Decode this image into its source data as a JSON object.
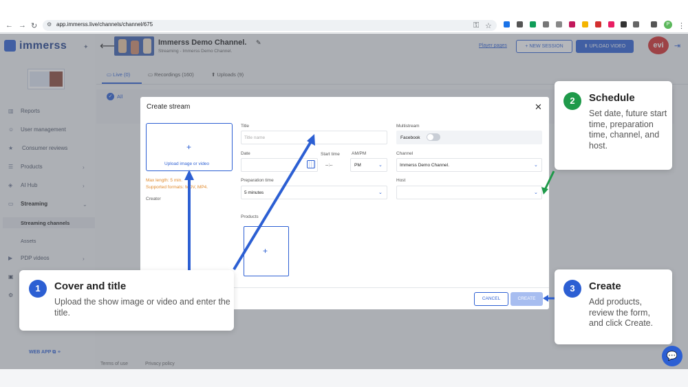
{
  "browser": {
    "url": "app.immerss.live/channels/channel/675",
    "profile_letter": "P"
  },
  "sidebar": {
    "logo_text": "immerss",
    "items": [
      {
        "label": "Reports",
        "icon": "bar-chart-icon"
      },
      {
        "label": "User management",
        "icon": "users-icon"
      },
      {
        "label": "Consumer reviews",
        "icon": "star-icon"
      },
      {
        "label": "Products",
        "icon": "list-icon"
      },
      {
        "label": "AI Hub",
        "icon": "ai-icon"
      },
      {
        "label": "Streaming",
        "icon": "streaming-icon"
      },
      {
        "label": "PDP videos",
        "icon": "video-icon"
      }
    ],
    "sub_items": [
      "Streaming channels",
      "Assets"
    ],
    "web_app": "WEB APP"
  },
  "header": {
    "channel_title": "Immerss Demo Channel.",
    "channel_subtitle": "Streaming - Immerss Demo Channel.",
    "player_pages": "Player pages",
    "new_session": "NEW SESSION",
    "upload_video": "UPLOAD VIDEO",
    "avatar_text": "evi"
  },
  "tabs": [
    {
      "label": "Live (0)"
    },
    {
      "label": "Recordings (160)"
    },
    {
      "label": "Uploads (9)"
    }
  ],
  "filter": {
    "all": "All"
  },
  "footer": {
    "terms": "Terms of use",
    "privacy": "Privacy policy"
  },
  "modal": {
    "title": "Create stream",
    "upload_label": "Upload image or video",
    "max_length": "Max length: 5 min.",
    "formats": "Supported formats: MOV, MP4.",
    "creator_label": "Creator",
    "title_label": "Title",
    "title_placeholder": "Title name",
    "date_label": "Date",
    "start_time_label": "Start time",
    "start_time_value": "--:--",
    "ampm_label": "AM/PM",
    "ampm_value": "PM",
    "prep_label": "Preparation time",
    "prep_value": "5 minutes",
    "multistream_label": "Multistream",
    "facebook_label": "Facebook",
    "channel_label": "Channel",
    "channel_value": "Immerss Demo Channel.",
    "host_label": "Host",
    "products_label": "Products",
    "cancel": "CANCEL",
    "create": "CREATE"
  },
  "callouts": [
    {
      "num": "1",
      "title": "Cover and title",
      "body": "Upload the show image or video and enter the title."
    },
    {
      "num": "2",
      "title": "Schedule",
      "body": "Set date, future start time, preparation time, channel, and host."
    },
    {
      "num": "3",
      "title": "Create",
      "body": "Add products, review the form, and click Create."
    }
  ],
  "colors": {
    "accent": "#2c5fd3",
    "step_blue": "#2c5fd3",
    "step_green": "#1f9a4a",
    "warning": "#e08a2c"
  }
}
